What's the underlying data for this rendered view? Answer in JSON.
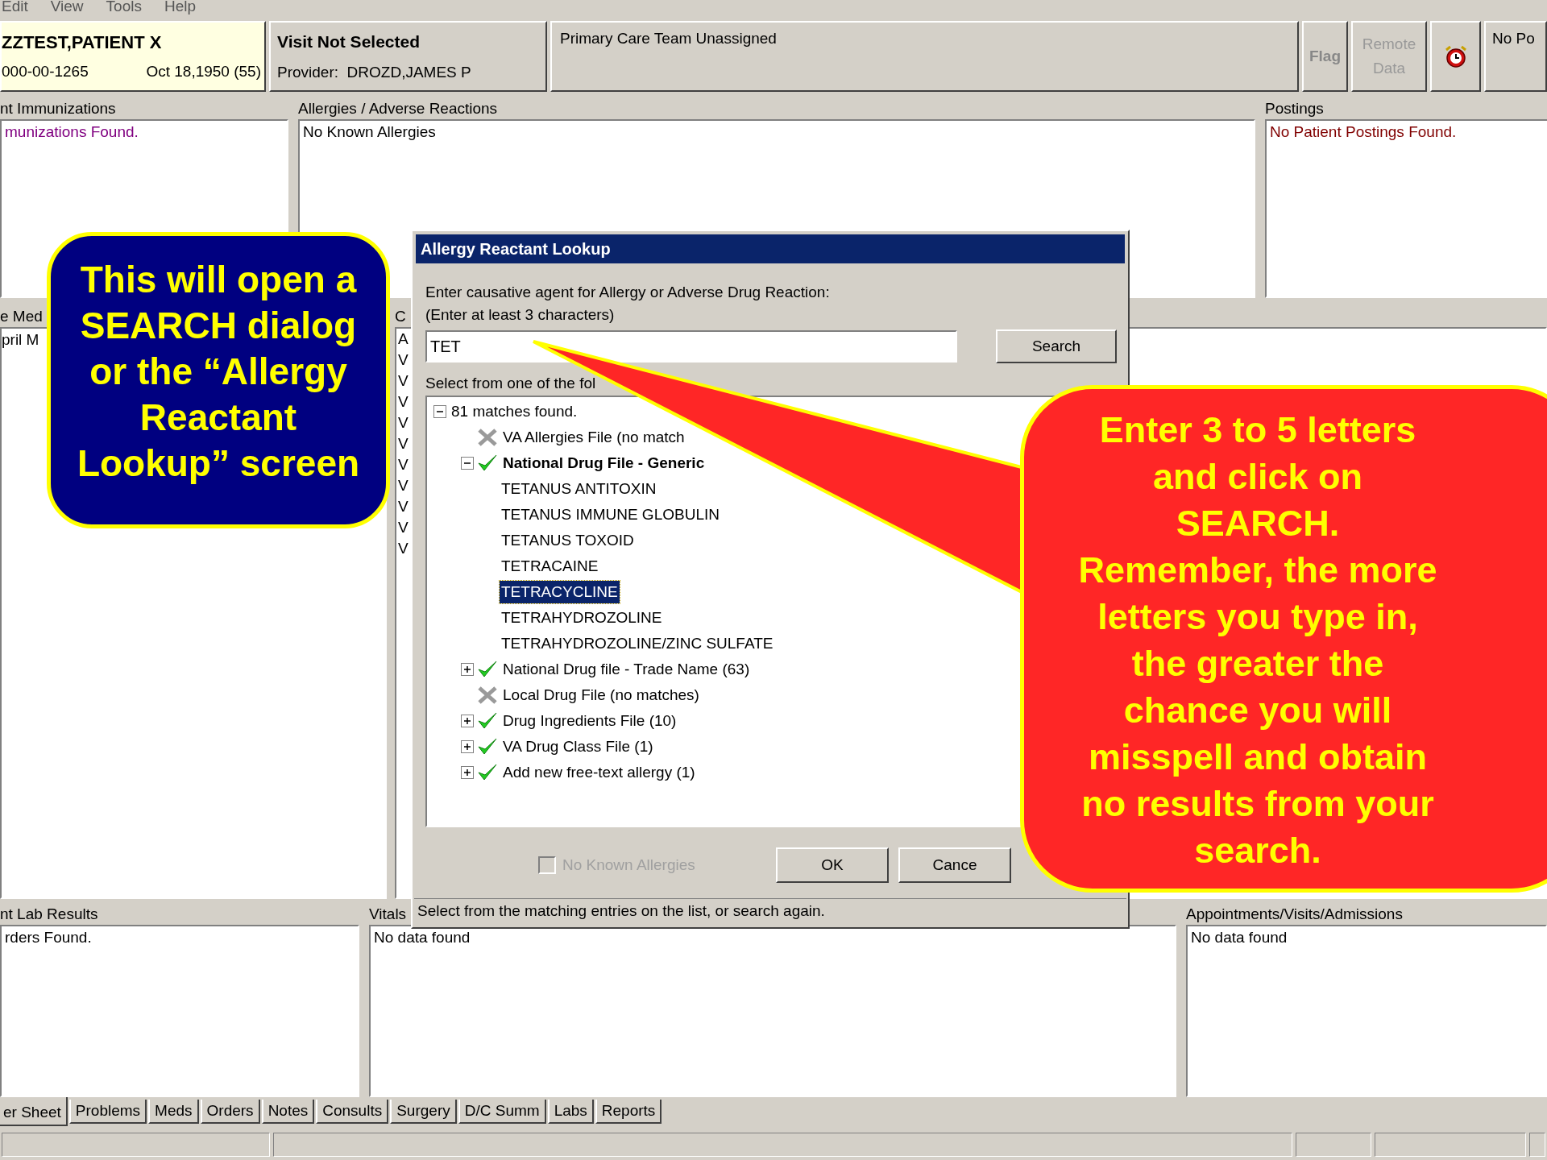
{
  "menu_bar": [
    "Edit",
    "View",
    "Tools",
    "Help"
  ],
  "patient": {
    "name": "ZZTEST,PATIENT X",
    "ssn": "000-00-1265",
    "dob": "Oct 18,1950 (55)"
  },
  "visit": {
    "title": "Visit Not Selected",
    "provider": "Provider:  DROZD,JAMES P"
  },
  "team": "Primary Care Team Unassigned",
  "toolbar": {
    "flag": "Flag",
    "remote_data": [
      "Remote",
      "Data"
    ],
    "postings_button": "No Po"
  },
  "top_panels": [
    {
      "title": "nt Immunizations",
      "text": "munizations Found.",
      "color": "#800080"
    },
    {
      "title": "Allergies / Adverse Reactions",
      "text": "No Known Allergies",
      "color": "#000000"
    },
    {
      "title": "Postings",
      "text": "No Patient Postings Found.",
      "color": "#800000"
    }
  ],
  "meds_panel": {
    "title": "e Med",
    "text": "pril M"
  },
  "column_2": {
    "title": "C",
    "cells": [
      "A",
      "V",
      "V",
      "V",
      "V",
      "V",
      "V",
      "V",
      "V",
      "V",
      "V"
    ]
  },
  "bottom_panels": [
    {
      "title": "nt Lab Results",
      "text": "rders Found."
    },
    {
      "title": "Vitals",
      "text": "No data found"
    },
    {
      "title": "Appointments/Visits/Admissions",
      "text": "No data found"
    }
  ],
  "tabs": [
    {
      "label": "er Sheet",
      "selected": true
    },
    {
      "label": "Problems",
      "selected": false
    },
    {
      "label": "Meds",
      "selected": false
    },
    {
      "label": "Orders",
      "selected": false
    },
    {
      "label": "Notes",
      "selected": false
    },
    {
      "label": "Consults",
      "selected": false
    },
    {
      "label": "Surgery",
      "selected": false
    },
    {
      "label": "D/C Summ",
      "selected": false
    },
    {
      "label": "Labs",
      "selected": false
    },
    {
      "label": "Reports",
      "selected": false
    }
  ],
  "dialog": {
    "title": "Allergy Reactant Lookup",
    "prompt": [
      "Enter causative agent for Allergy or Adverse Drug Reaction:",
      "(Enter at least 3 characters)"
    ],
    "search_value": "TET",
    "search_button": "Search",
    "list_label": "Select from one of the fol",
    "tree": {
      "label": "81 matches found.",
      "expanded": true,
      "children": [
        {
          "label": "VA Allergies File  (no match",
          "kind": "none"
        },
        {
          "label": "National Drug File - Generic",
          "kind": "match",
          "expanded": true,
          "children": [
            {
              "label": "TETANUS ANTITOXIN",
              "selected": false
            },
            {
              "label": "TETANUS IMMUNE GLOBULIN",
              "selected": false
            },
            {
              "label": "TETANUS TOXOID",
              "selected": false
            },
            {
              "label": "TETRACAINE",
              "selected": false
            },
            {
              "label": "TETRACYCLINE",
              "selected": true
            },
            {
              "label": "TETRAHYDROZOLINE",
              "selected": false
            },
            {
              "label": "TETRAHYDROZOLINE/ZINC SULFATE",
              "selected": false
            }
          ]
        },
        {
          "label": "National Drug file - Trade Name  (63)",
          "kind": "match",
          "expanded": false
        },
        {
          "label": "Local Drug File  (no matches)",
          "kind": "none"
        },
        {
          "label": "Drug Ingredients File  (10)",
          "kind": "match",
          "expanded": false
        },
        {
          "label": "VA Drug Class File  (1)",
          "kind": "match",
          "expanded": false
        },
        {
          "label": "Add new free-text allergy  (1)",
          "kind": "match",
          "expanded": false
        }
      ]
    },
    "checkbox": {
      "label": "No Known Allergies",
      "checked": false,
      "disabled": true
    },
    "ok_button": "OK",
    "cancel_button": "Cance",
    "status": "Select from the matching entries on the list, or search again."
  },
  "callouts": [
    {
      "kind": "blue",
      "lines": [
        "This will open a",
        "SEARCH dialog",
        "or the “Allergy",
        "Reactant",
        "Lookup” screen"
      ]
    },
    {
      "kind": "red",
      "lines": [
        "Enter 3 to 5 letters",
        "and click on",
        "SEARCH.",
        "Remember, the more",
        "letters you type in,",
        "the greater the",
        "chance you will",
        "misspell and obtain",
        "no results from your",
        "search."
      ]
    }
  ]
}
